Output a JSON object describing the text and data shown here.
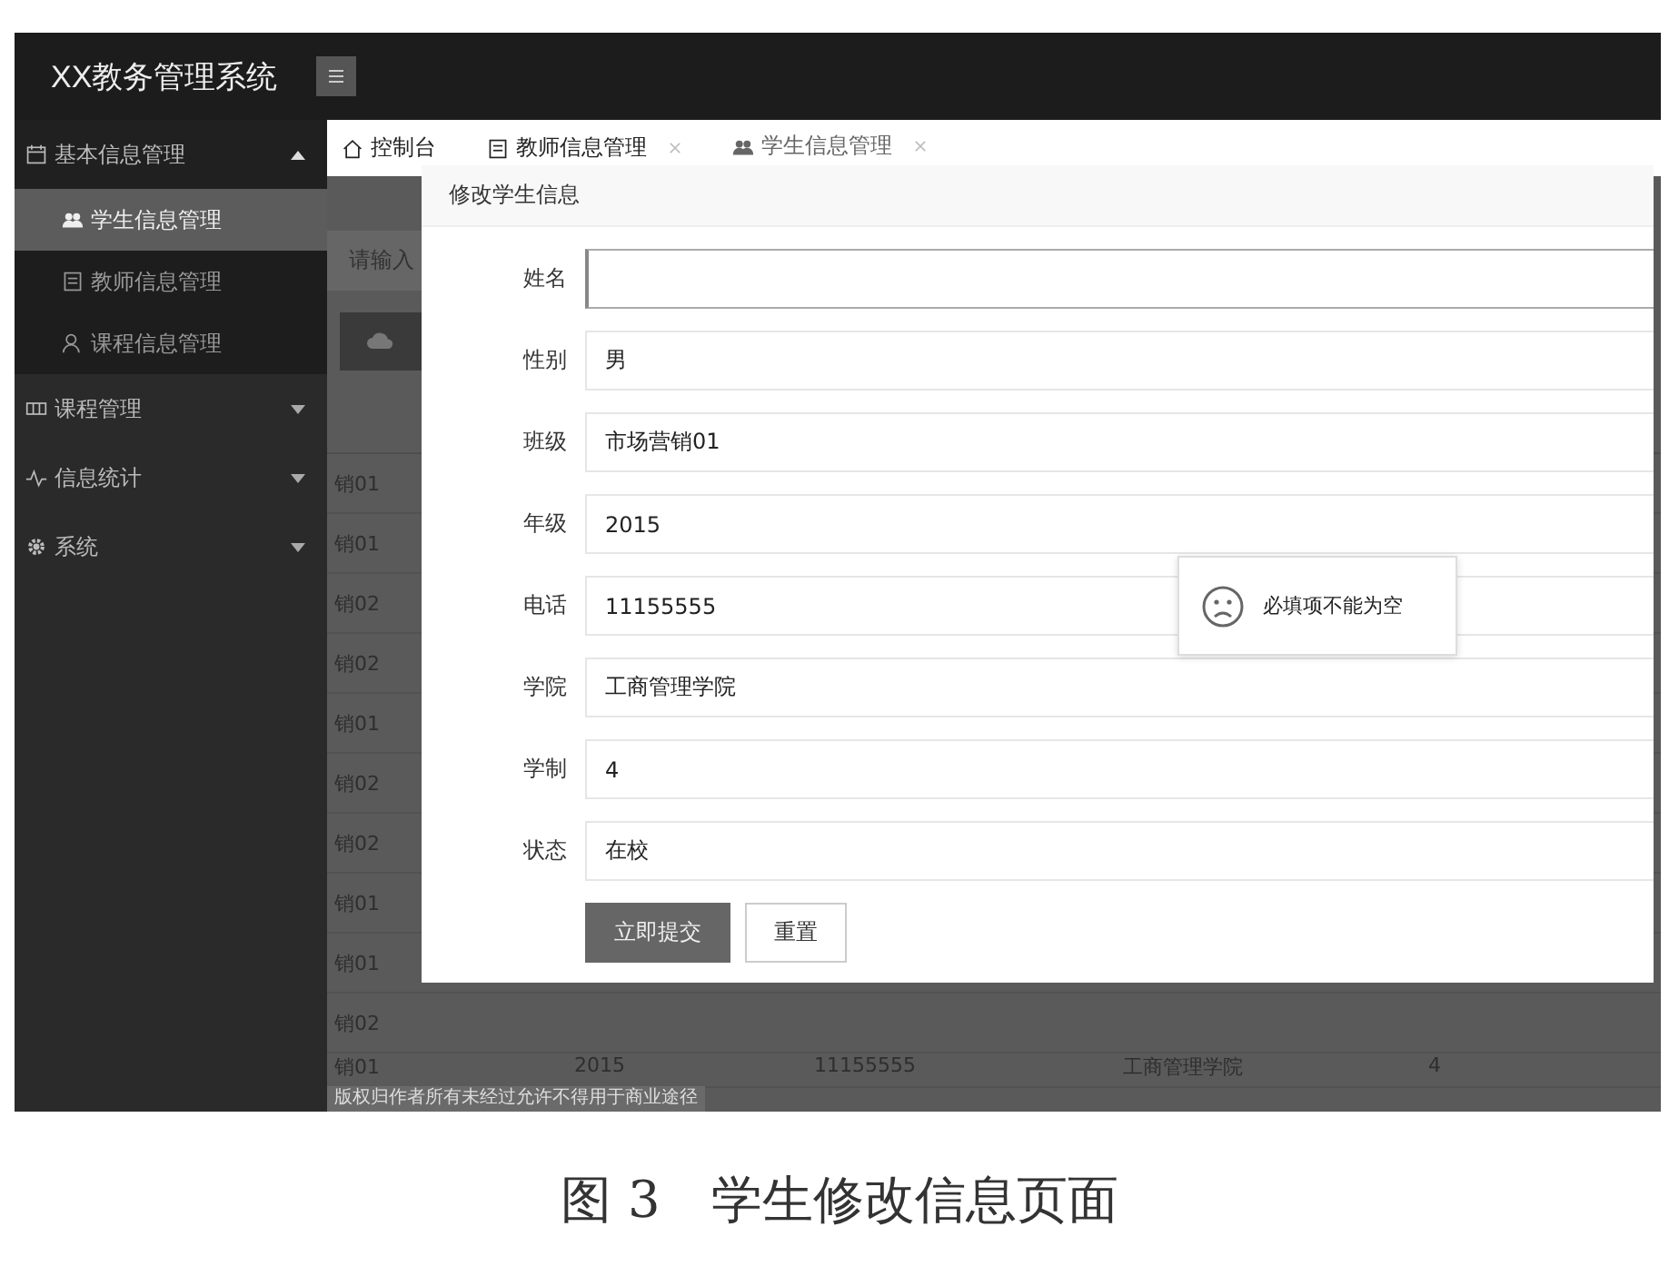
{
  "app_title": "XX教务管理系统",
  "sidebar": {
    "items": [
      {
        "label": "基本信息管理",
        "expanded": true,
        "children": [
          {
            "label": "学生信息管理",
            "selected": true
          },
          {
            "label": "教师信息管理",
            "selected": false
          },
          {
            "label": "课程信息管理",
            "selected": false
          }
        ]
      },
      {
        "label": "课程管理",
        "expanded": false
      },
      {
        "label": "信息统计",
        "expanded": false
      },
      {
        "label": "系统",
        "expanded": false
      }
    ]
  },
  "tabs": [
    {
      "label": "控制台",
      "closable": false,
      "selected": false
    },
    {
      "label": "教师信息管理",
      "closable": true,
      "selected": false
    },
    {
      "label": "学生信息管理",
      "closable": true,
      "selected": true
    }
  ],
  "background": {
    "search": {
      "placeholder": "请输入"
    },
    "rows": [
      {
        "column_1": "销01"
      },
      {
        "column_1": "销01"
      },
      {
        "column_1": "销02"
      },
      {
        "column_1": "销02"
      },
      {
        "column_1": "销01"
      },
      {
        "column_1": "销02"
      },
      {
        "column_1": "销02"
      },
      {
        "column_1": "销01"
      },
      {
        "column_1": "销01"
      },
      {
        "column_1": "销02"
      }
    ],
    "last_row": {
      "column_1": "销01",
      "column_2": "2015",
      "column_3": "11155555",
      "column_4": "工商管理学院",
      "column_5": "4"
    },
    "notice": "版权归作者所有未经过允许不得用于商业途径"
  },
  "dialog": {
    "title": "修改学生信息",
    "fields": [
      {
        "label": "姓名",
        "focused": true
      },
      {
        "label": "性别",
        "value": "男",
        "focused": false
      },
      {
        "label": "班级",
        "value": "市场营销01",
        "focused": false
      },
      {
        "label": "年级",
        "value": "2015",
        "focused": false
      },
      {
        "label": "电话",
        "value": "11155555",
        "focused": false
      },
      {
        "label": "学院",
        "value": "工商管理学院",
        "focused": false
      },
      {
        "label": "学制",
        "value": "4",
        "focused": false
      },
      {
        "label": "状态",
        "value": "在校",
        "focused": false
      }
    ],
    "buttons": [
      {
        "label": "立即提交",
        "kind": "primary"
      },
      {
        "label": "重置",
        "kind": "secondary"
      }
    ],
    "toast": {
      "text": "必填项不能为空"
    }
  },
  "caption": "图 3　学生修改信息页面"
}
